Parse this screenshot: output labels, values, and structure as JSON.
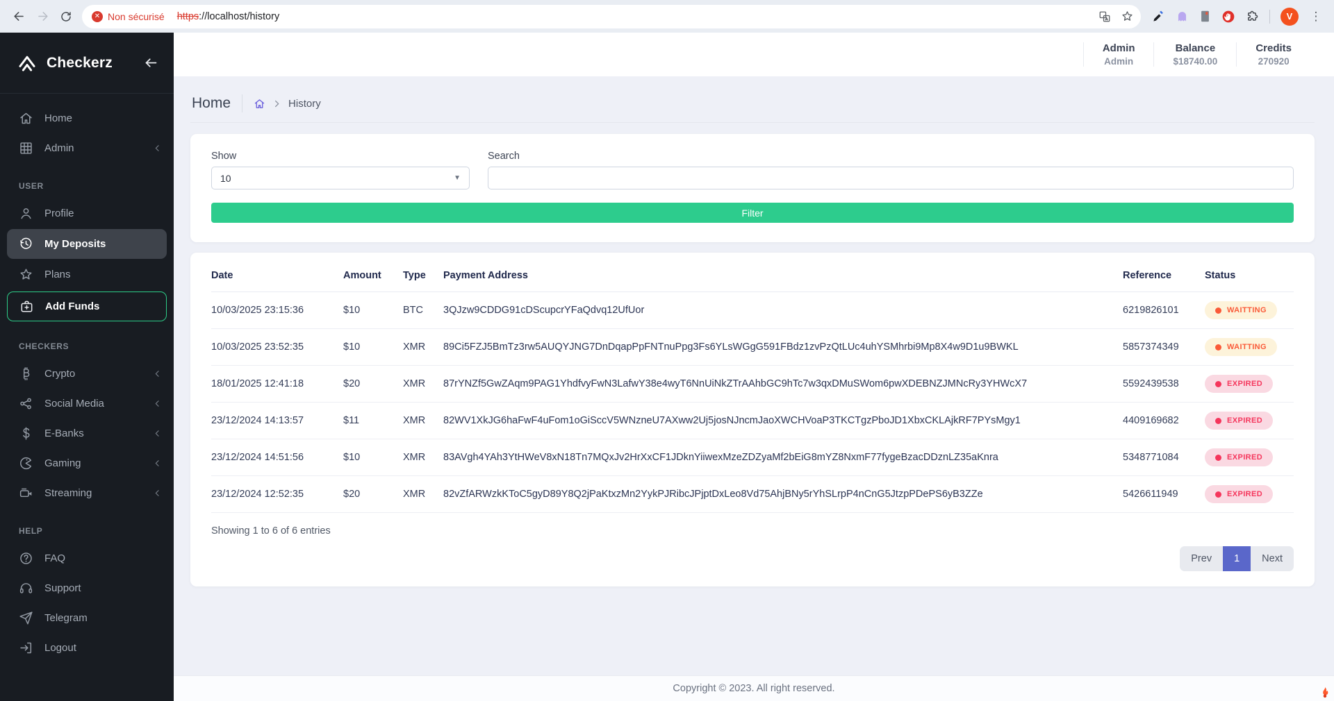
{
  "browser": {
    "security_warning": "Non sécurisé",
    "url_struck": "https",
    "url_rest": "://localhost/history",
    "avatar_letter": "V"
  },
  "sidebar": {
    "brand": "Checkerz",
    "groups": [
      {
        "label": "",
        "items": [
          {
            "label": "Home",
            "icon": "home-icon"
          },
          {
            "label": "Admin",
            "icon": "grid-icon",
            "chevron": true
          }
        ]
      },
      {
        "label": "USER",
        "items": [
          {
            "label": "Profile",
            "icon": "user-icon"
          },
          {
            "label": "My Deposits",
            "icon": "history-icon",
            "active": true
          },
          {
            "label": "Plans",
            "icon": "star-icon"
          },
          {
            "label": "Add Funds",
            "icon": "briefcase-plus-icon",
            "outlined": true
          }
        ]
      },
      {
        "label": "CHECKERS",
        "items": [
          {
            "label": "Crypto",
            "icon": "bitcoin-icon",
            "chevron": true
          },
          {
            "label": "Social Media",
            "icon": "share-icon",
            "chevron": true
          },
          {
            "label": "E-Banks",
            "icon": "dollar-icon",
            "chevron": true
          },
          {
            "label": "Gaming",
            "icon": "pacman-icon",
            "chevron": true
          },
          {
            "label": "Streaming",
            "icon": "video-icon",
            "chevron": true
          }
        ]
      },
      {
        "label": "HELP",
        "items": [
          {
            "label": "FAQ",
            "icon": "question-icon"
          },
          {
            "label": "Support",
            "icon": "headset-icon"
          },
          {
            "label": "Telegram",
            "icon": "telegram-icon"
          },
          {
            "label": "Logout",
            "icon": "logout-icon"
          }
        ]
      }
    ]
  },
  "header": {
    "user_label": "Admin",
    "user_value": "Admin",
    "balance_label": "Balance",
    "balance_value": "$18740.00",
    "credits_label": "Credits",
    "credits_value": "270920"
  },
  "breadcrumb": {
    "title": "Home",
    "page": "History"
  },
  "filter": {
    "show_label": "Show",
    "show_value": "10",
    "search_label": "Search",
    "search_value": "",
    "button_label": "Filter"
  },
  "table": {
    "headers": [
      "Date",
      "Amount",
      "Type",
      "Payment Address",
      "Reference",
      "Status"
    ],
    "rows": [
      {
        "date": "10/03/2025 23:15:36",
        "amount": "$10",
        "type": "BTC",
        "address": "3QJzw9CDDG91cDScupcrYFaQdvq12UfUor",
        "reference": "6219826101",
        "status": "WAITTING",
        "status_type": "waiting"
      },
      {
        "date": "10/03/2025 23:52:35",
        "amount": "$10",
        "type": "XMR",
        "address": "89Ci5FZJ5BmTz3rw5AUQYJNG7DnDqapPpFNTnuPpg3Fs6YLsWGgG591FBdz1zvPzQtLUc4uhYSMhrbi9Mp8X4w9D1u9BWKL",
        "reference": "5857374349",
        "status": "WAITTING",
        "status_type": "waiting"
      },
      {
        "date": "18/01/2025 12:41:18",
        "amount": "$20",
        "type": "XMR",
        "address": "87rYNZf5GwZAqm9PAG1YhdfvyFwN3LafwY38e4wyT6NnUiNkZTrAAhbGC9hTc7w3qxDMuSWom6pwXDEBNZJMNcRy3YHWcX7",
        "reference": "5592439538",
        "status": "EXPIRED",
        "status_type": "expired"
      },
      {
        "date": "23/12/2024 14:13:57",
        "amount": "$11",
        "type": "XMR",
        "address": "82WV1XkJG6haFwF4uFom1oGiSccV5WNzneU7AXww2Uj5josNJncmJaoXWCHVoaP3TKCTgzPboJD1XbxCKLAjkRF7PYsMgy1",
        "reference": "4409169682",
        "status": "EXPIRED",
        "status_type": "expired"
      },
      {
        "date": "23/12/2024 14:51:56",
        "amount": "$10",
        "type": "XMR",
        "address": "83AVgh4YAh3YtHWeV8xN18Tn7MQxJv2HrXxCF1JDknYiiwexMzeZDZyaMf2bEiG8mYZ8NxmF77fygeBzacDDznLZ35aKnra",
        "reference": "5348771084",
        "status": "EXPIRED",
        "status_type": "expired"
      },
      {
        "date": "23/12/2024 12:52:35",
        "amount": "$20",
        "type": "XMR",
        "address": "82vZfARWzkKToC5gyD89Y8Q2jPaKtxzMn2YykPJRibcJPjptDxLeo8Vd75AhjBNy5rYhSLrpP4nCnG5JtzpPDePS6yB3ZZe",
        "reference": "5426611949",
        "status": "EXPIRED",
        "status_type": "expired"
      }
    ],
    "summary": "Showing 1 to 6 of 6 entries"
  },
  "pagination": {
    "prev": "Prev",
    "current": "1",
    "next": "Next"
  },
  "footer": {
    "copyright": "Copyright © 2023. All right reserved."
  },
  "colors": {
    "sidebar_bg": "#181c22",
    "accent_green": "#2dcc8d",
    "add_funds_border": "#2dce89",
    "pagination_active": "#5a67ca",
    "status_waiting": "#fa5a38",
    "status_waiting_bg": "#fdf3da",
    "status_expired": "#f5365c",
    "status_expired_bg": "#fad9e2",
    "breadcrumb_icon": "#6a5fdc",
    "avatar_bg": "#f4511e",
    "security_red": "#d93a2e"
  }
}
